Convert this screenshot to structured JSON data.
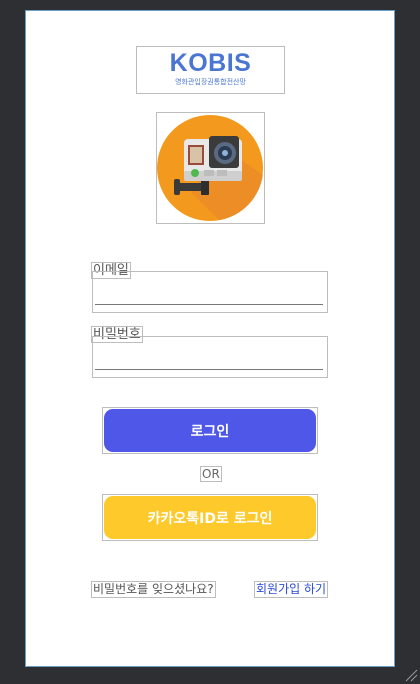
{
  "logo": {
    "main": "KOBIS",
    "sub": "영화관입장권통합전산망"
  },
  "form": {
    "email_label": "이메일",
    "email_value": "",
    "password_label": "비밀번호",
    "password_value": ""
  },
  "buttons": {
    "login": "로그인",
    "or": "OR",
    "kakao": "카카오톡ID로 로그인"
  },
  "links": {
    "forgot_password": "비밀번호를 잊으셨나요?",
    "signup": "회원가입 하기"
  },
  "colors": {
    "login_button": "#4f57e8",
    "kakao_button": "#fdc92b",
    "brand": "#4a76d1",
    "signup_link": "#2a4ad6"
  }
}
